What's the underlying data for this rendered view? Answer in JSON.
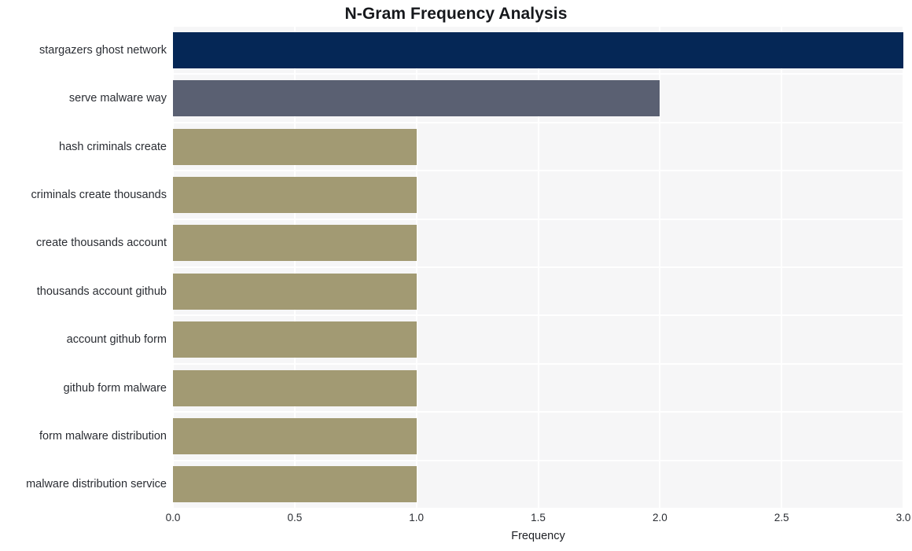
{
  "chart_data": {
    "type": "bar",
    "orientation": "horizontal",
    "title": "N-Gram Frequency Analysis",
    "xlabel": "Frequency",
    "ylabel": "",
    "categories": [
      "stargazers ghost network",
      "serve malware way",
      "hash criminals create",
      "criminals create thousands",
      "create thousands account",
      "thousands account github",
      "account github form",
      "github form malware",
      "form malware distribution",
      "malware distribution service"
    ],
    "values": [
      3,
      2,
      1,
      1,
      1,
      1,
      1,
      1,
      1,
      1
    ],
    "bar_colors": [
      "#052756",
      "#5a6072",
      "#a29a73",
      "#a29a73",
      "#a29a73",
      "#a29a73",
      "#a29a73",
      "#a29a73",
      "#a29a73",
      "#a29a73"
    ],
    "xlim": [
      0.0,
      3.0
    ],
    "xticks": [
      0.0,
      0.5,
      1.0,
      1.5,
      2.0,
      2.5,
      3.0
    ],
    "xtick_labels": [
      "0.0",
      "0.5",
      "1.0",
      "1.5",
      "2.0",
      "2.5",
      "3.0"
    ],
    "grid": true,
    "grid_color": "#ffffff",
    "plot_background": "#f6f6f7",
    "figure_background": "#ffffff",
    "legend": null,
    "legend_position": "none"
  }
}
